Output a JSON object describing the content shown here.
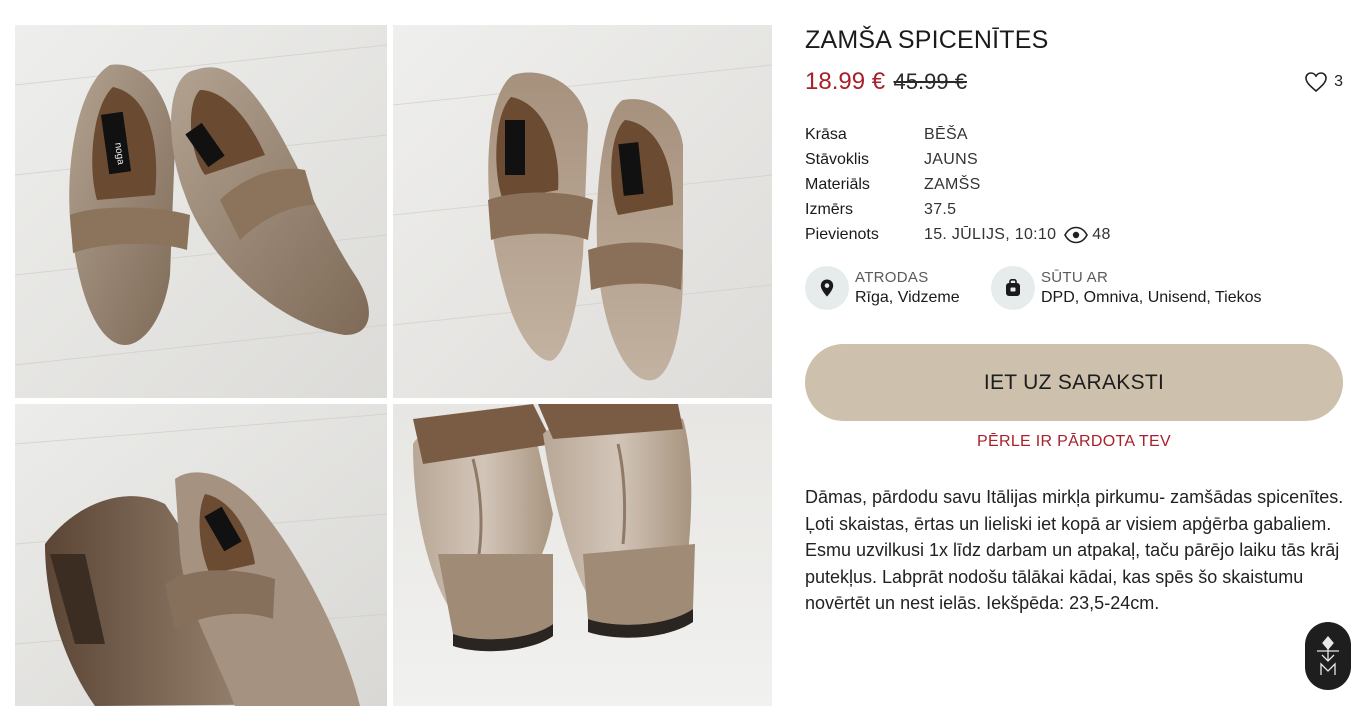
{
  "listing": {
    "title": "ZAMŠA SPICENĪTES",
    "price": "18.99 €",
    "old_price": "45.99 €",
    "favorites_count": "3",
    "attributes": [
      {
        "label": "Krāsa",
        "value": "BĒŠA"
      },
      {
        "label": "Stāvoklis",
        "value": "JAUNS"
      },
      {
        "label": "Materiāls",
        "value": "ZAMŠS"
      },
      {
        "label": "Izmērs",
        "value": "37.5"
      },
      {
        "label": "Pievienots",
        "value": "15. JŪLIJS, 10:10"
      }
    ],
    "views_count": "48",
    "location": {
      "label": "ATRODAS",
      "value": "Rīga, Vidzeme"
    },
    "shipping": {
      "label": "SŪTU AR",
      "value": "DPD, Omniva, Unisend, Tiekos"
    },
    "cta_label": "IET UZ SARAKSTI",
    "sold_notice": "PĒRLE IR PĀRDOTA TEV",
    "description": "Dāmas, pārdodu savu Itālijas mirkļa pirkumu- zamšādas spicenītes. Ļoti skaistas, ērtas un lieliski iet kopā ar visiem apģērba gabaliem. Esmu uzvilkusi 1x līdz darbam un atpakaļ, taču pārējo laiku tās krāj putekļus. Labprāt nodošu tālākai kādai, kas spēs šo skaistumu novērtēt un nest ielās. Iekšpēda: 23,5-24cm.",
    "photos": [
      {
        "shoe_brand_label": "noga"
      },
      {
        "shoe_brand_label": "noga"
      },
      {
        "shoe_brand_label": "noga"
      },
      {
        "shoe_brand_label": ""
      }
    ]
  },
  "icons": {
    "favorite": "heart-outline-icon",
    "views": "eye-icon",
    "location": "location-pin-icon",
    "shipping": "package-icon",
    "floating": "brand-logo-icon"
  },
  "colors": {
    "price": "#a8202a",
    "cta_background": "#cdc0ad",
    "icon_circle": "#e6ecec"
  }
}
